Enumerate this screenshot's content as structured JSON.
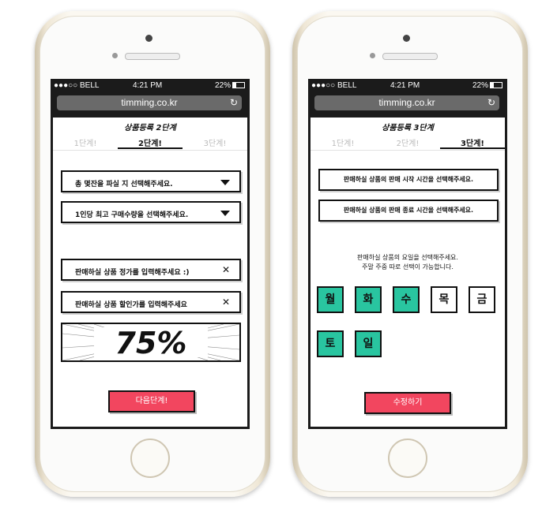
{
  "status": {
    "carrier": "●●●○○ BELL",
    "time": "4:21 PM",
    "battery": "22%"
  },
  "url": "timming.co.kr",
  "reload_glyph": "↻",
  "tabs": [
    "1단계!",
    "2단계!",
    "3단계!"
  ],
  "left": {
    "title": "상품등록 2단계",
    "field1": "총 몇잔을 파실 지 선택해주세요.",
    "field2": "1인당 최고 구매수량을 선택해주세요.",
    "field3": "판매하실 상품 정가를 입력해주세요 :)",
    "field4": "판매하실 상품 할인가를 입력해주세요",
    "clear_glyph": "✕",
    "discount": "75%",
    "next_button": "다음단계!"
  },
  "right": {
    "title": "상품등록 3단계",
    "start_time": "판매하실 상품의 판매 시작 시간을 선택해주세요.",
    "end_time": "판매하실 상품의 판매 종료 시간을 선택해주세요.",
    "days_hint1": "판매하실 상품의 요일을 선택해주세요.",
    "days_hint2": "주말 주중 따로 선택이 가능합니다.",
    "days": [
      {
        "label": "월",
        "selected": true
      },
      {
        "label": "화",
        "selected": true
      },
      {
        "label": "수",
        "selected": true
      },
      {
        "label": "목",
        "selected": false
      },
      {
        "label": "금",
        "selected": false
      },
      {
        "label": "토",
        "selected": true
      },
      {
        "label": "일",
        "selected": true
      }
    ],
    "edit_button": "수정하기"
  },
  "colors": {
    "accent_red": "#f2465f",
    "day_selected": "#29c5a0"
  }
}
